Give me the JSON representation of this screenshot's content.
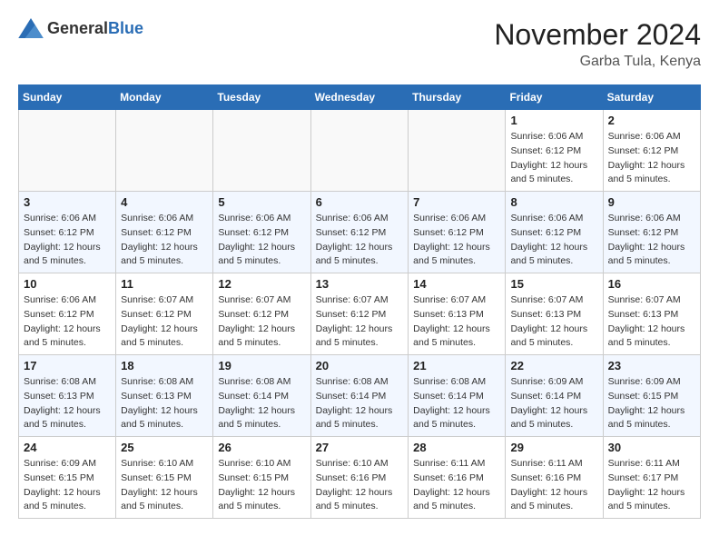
{
  "header": {
    "logo_general": "General",
    "logo_blue": "Blue",
    "month_title": "November 2024",
    "location": "Garba Tula, Kenya"
  },
  "weekdays": [
    "Sunday",
    "Monday",
    "Tuesday",
    "Wednesday",
    "Thursday",
    "Friday",
    "Saturday"
  ],
  "weeks": [
    [
      {
        "day": "",
        "info": ""
      },
      {
        "day": "",
        "info": ""
      },
      {
        "day": "",
        "info": ""
      },
      {
        "day": "",
        "info": ""
      },
      {
        "day": "",
        "info": ""
      },
      {
        "day": "1",
        "info": "Sunrise: 6:06 AM\nSunset: 6:12 PM\nDaylight: 12 hours\nand 5 minutes."
      },
      {
        "day": "2",
        "info": "Sunrise: 6:06 AM\nSunset: 6:12 PM\nDaylight: 12 hours\nand 5 minutes."
      }
    ],
    [
      {
        "day": "3",
        "info": "Sunrise: 6:06 AM\nSunset: 6:12 PM\nDaylight: 12 hours\nand 5 minutes."
      },
      {
        "day": "4",
        "info": "Sunrise: 6:06 AM\nSunset: 6:12 PM\nDaylight: 12 hours\nand 5 minutes."
      },
      {
        "day": "5",
        "info": "Sunrise: 6:06 AM\nSunset: 6:12 PM\nDaylight: 12 hours\nand 5 minutes."
      },
      {
        "day": "6",
        "info": "Sunrise: 6:06 AM\nSunset: 6:12 PM\nDaylight: 12 hours\nand 5 minutes."
      },
      {
        "day": "7",
        "info": "Sunrise: 6:06 AM\nSunset: 6:12 PM\nDaylight: 12 hours\nand 5 minutes."
      },
      {
        "day": "8",
        "info": "Sunrise: 6:06 AM\nSunset: 6:12 PM\nDaylight: 12 hours\nand 5 minutes."
      },
      {
        "day": "9",
        "info": "Sunrise: 6:06 AM\nSunset: 6:12 PM\nDaylight: 12 hours\nand 5 minutes."
      }
    ],
    [
      {
        "day": "10",
        "info": "Sunrise: 6:06 AM\nSunset: 6:12 PM\nDaylight: 12 hours\nand 5 minutes."
      },
      {
        "day": "11",
        "info": "Sunrise: 6:07 AM\nSunset: 6:12 PM\nDaylight: 12 hours\nand 5 minutes."
      },
      {
        "day": "12",
        "info": "Sunrise: 6:07 AM\nSunset: 6:12 PM\nDaylight: 12 hours\nand 5 minutes."
      },
      {
        "day": "13",
        "info": "Sunrise: 6:07 AM\nSunset: 6:12 PM\nDaylight: 12 hours\nand 5 minutes."
      },
      {
        "day": "14",
        "info": "Sunrise: 6:07 AM\nSunset: 6:13 PM\nDaylight: 12 hours\nand 5 minutes."
      },
      {
        "day": "15",
        "info": "Sunrise: 6:07 AM\nSunset: 6:13 PM\nDaylight: 12 hours\nand 5 minutes."
      },
      {
        "day": "16",
        "info": "Sunrise: 6:07 AM\nSunset: 6:13 PM\nDaylight: 12 hours\nand 5 minutes."
      }
    ],
    [
      {
        "day": "17",
        "info": "Sunrise: 6:08 AM\nSunset: 6:13 PM\nDaylight: 12 hours\nand 5 minutes."
      },
      {
        "day": "18",
        "info": "Sunrise: 6:08 AM\nSunset: 6:13 PM\nDaylight: 12 hours\nand 5 minutes."
      },
      {
        "day": "19",
        "info": "Sunrise: 6:08 AM\nSunset: 6:14 PM\nDaylight: 12 hours\nand 5 minutes."
      },
      {
        "day": "20",
        "info": "Sunrise: 6:08 AM\nSunset: 6:14 PM\nDaylight: 12 hours\nand 5 minutes."
      },
      {
        "day": "21",
        "info": "Sunrise: 6:08 AM\nSunset: 6:14 PM\nDaylight: 12 hours\nand 5 minutes."
      },
      {
        "day": "22",
        "info": "Sunrise: 6:09 AM\nSunset: 6:14 PM\nDaylight: 12 hours\nand 5 minutes."
      },
      {
        "day": "23",
        "info": "Sunrise: 6:09 AM\nSunset: 6:15 PM\nDaylight: 12 hours\nand 5 minutes."
      }
    ],
    [
      {
        "day": "24",
        "info": "Sunrise: 6:09 AM\nSunset: 6:15 PM\nDaylight: 12 hours\nand 5 minutes."
      },
      {
        "day": "25",
        "info": "Sunrise: 6:10 AM\nSunset: 6:15 PM\nDaylight: 12 hours\nand 5 minutes."
      },
      {
        "day": "26",
        "info": "Sunrise: 6:10 AM\nSunset: 6:15 PM\nDaylight: 12 hours\nand 5 minutes."
      },
      {
        "day": "27",
        "info": "Sunrise: 6:10 AM\nSunset: 6:16 PM\nDaylight: 12 hours\nand 5 minutes."
      },
      {
        "day": "28",
        "info": "Sunrise: 6:11 AM\nSunset: 6:16 PM\nDaylight: 12 hours\nand 5 minutes."
      },
      {
        "day": "29",
        "info": "Sunrise: 6:11 AM\nSunset: 6:16 PM\nDaylight: 12 hours\nand 5 minutes."
      },
      {
        "day": "30",
        "info": "Sunrise: 6:11 AM\nSunset: 6:17 PM\nDaylight: 12 hours\nand 5 minutes."
      }
    ]
  ]
}
